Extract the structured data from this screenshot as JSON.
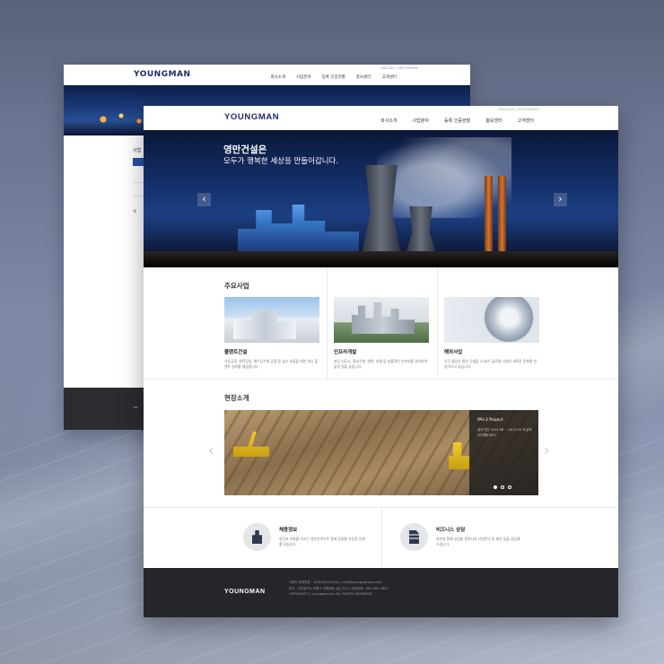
{
  "brand": {
    "logo": "YOUNGMAN"
  },
  "utility_links": "ENGLISH | GROUPWARE",
  "nav": [
    "회사소개",
    "사업분야",
    "등록 인증현황",
    "홍보센터",
    "고객센터"
  ],
  "hero": {
    "title": "영만건설은",
    "subtitle": "모두가 행복한 세상을 만들어갑니다.",
    "prev": "‹",
    "next": "›"
  },
  "business": {
    "title": "주요사업",
    "items": [
      {
        "name": "플랜트건설",
        "desc": "석유공정, 화학공정, 해수담수화 공정 등 높은 효율을 위한 최신 플랜트 설비를 제공합니다."
      },
      {
        "name": "인프라개발",
        "desc": "분당 신도시, 필교건설, 병원, 호텔 등 효율적인 인프라를 관리하여 삶의 질을 높입니다."
      },
      {
        "name": "해외사업",
        "desc": "인간 중심의 첨보 건설을 21세기 글로벌 시대의 새로운 문화를 만들어가고 있습니다."
      }
    ]
  },
  "projects": {
    "title": "현장소개",
    "overlay_name": "IPU-2 Project",
    "overlay_detail": "공사기간 2011.06 ~ 2013.09 도급액 20억원(VAT)",
    "prev": "‹",
    "next": "›"
  },
  "info": {
    "items": [
      {
        "title": "채용정보",
        "desc": "성장과 조화를 이끄는 영만가족으로 함께 성장할 유능한 인재를 모십니다."
      },
      {
        "title": "비즈니스 상담",
        "desc": "영만과 함께 성장할 협력사의 사업문의 및 제안 등을 상담해 드립니다."
      }
    ]
  },
  "footer": {
    "logo": "YOUNGMAN",
    "line1": "사업자 등록번호 : 1001002(10000) | info@youngmancon.com",
    "line2": "본사 : 인천광역시 부평구 부평대로 4길 30-4 | 대표전화 : 061-981-3807",
    "line3": "COPYRIGHT ⓒ youngmancon ALL RIGHTS RESERVED."
  },
  "back_page": {
    "side_title": "사업",
    "side_small": "해"
  }
}
